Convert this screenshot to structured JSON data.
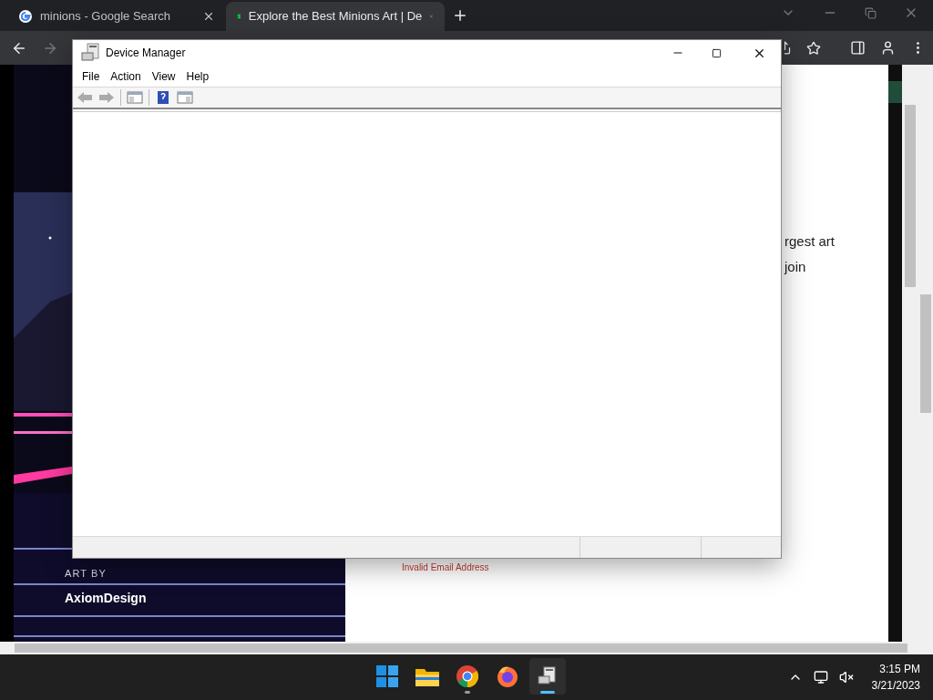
{
  "browser": {
    "tabs": [
      {
        "title": "minions - Google Search",
        "selected": false
      },
      {
        "title": "Explore the Best Minions Art | De",
        "selected": true
      }
    ]
  },
  "page": {
    "artwork": {
      "label": "ART BY",
      "artist": "AxiomDesign"
    },
    "text_lines": [
      "rgest art",
      "join"
    ],
    "error": "Invalid Email Address"
  },
  "device_manager": {
    "title": "Device Manager",
    "menu": [
      "File",
      "Action",
      "View",
      "Help"
    ]
  },
  "taskbar": {
    "apps": [
      {
        "kind": "start",
        "running": false,
        "selected": false
      },
      {
        "kind": "explorer",
        "running": false,
        "selected": false
      },
      {
        "kind": "chrome",
        "running": true,
        "selected": false
      },
      {
        "kind": "firefox",
        "running": false,
        "selected": false
      },
      {
        "kind": "devmgr",
        "running": true,
        "selected": true
      }
    ],
    "time": "3:15 PM",
    "date": "3/21/2023"
  }
}
